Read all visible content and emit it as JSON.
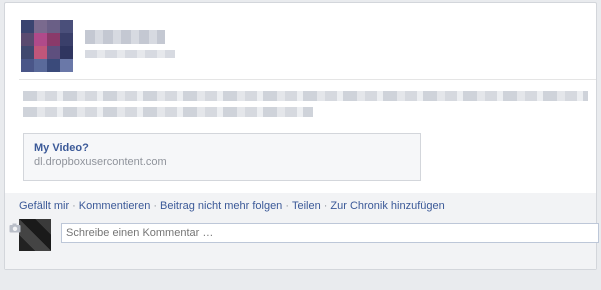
{
  "post": {
    "author_name": "",
    "timestamp": "",
    "link_preview": {
      "title": "My Video?",
      "domain": "dl.dropboxusercontent.com"
    }
  },
  "actions": {
    "like": "Gefällt mir",
    "comment": "Kommentieren",
    "unfollow": "Beitrag nicht mehr folgen",
    "share": "Teilen",
    "add_to_timeline": "Zur Chronik hinzufügen",
    "separator": "·"
  },
  "comment_box": {
    "placeholder": "Schreibe einen Kommentar …"
  },
  "colors": {
    "link": "#3b5998",
    "muted": "#90949c",
    "background": "#e9ebee",
    "action_bar": "#f2f3f5"
  },
  "icons": [
    "camera-icon"
  ]
}
